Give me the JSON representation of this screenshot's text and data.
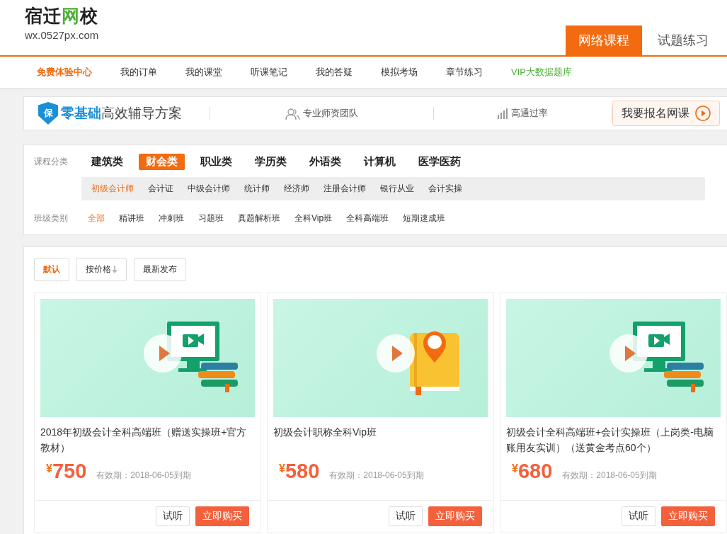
{
  "logo": {
    "title_parts": [
      {
        "text": "宿迁",
        "accent": false
      },
      {
        "text": "网",
        "accent": true
      },
      {
        "text": "校",
        "accent": false
      }
    ],
    "url": "wx.0527px.com"
  },
  "top_tabs": [
    {
      "label": "网络课程",
      "selected": true
    },
    {
      "label": "试题练习",
      "selected": false
    }
  ],
  "nav": [
    {
      "label": "免费体验中心",
      "selected": true,
      "kind": "normal"
    },
    {
      "label": "我的订单",
      "selected": false,
      "kind": "normal"
    },
    {
      "label": "我的课堂",
      "selected": false,
      "kind": "normal"
    },
    {
      "label": "听课笔记",
      "selected": false,
      "kind": "normal"
    },
    {
      "label": "我的答疑",
      "selected": false,
      "kind": "normal"
    },
    {
      "label": "模拟考场",
      "selected": false,
      "kind": "normal"
    },
    {
      "label": "章节练习",
      "selected": false,
      "kind": "normal"
    },
    {
      "label": "VIP大数据题库",
      "selected": false,
      "kind": "vip"
    }
  ],
  "promo": {
    "badge": "保",
    "title_accent": "零基础",
    "title": "高效辅导方案",
    "features": [
      {
        "kind": "team",
        "label": "专业师资团队"
      },
      {
        "kind": "rate",
        "label": "高通过率"
      }
    ],
    "cta": "我要报名网课"
  },
  "filters": {
    "category_label": "课程分类",
    "categories": [
      {
        "label": "建筑类",
        "selected": false
      },
      {
        "label": "财会类",
        "selected": true
      },
      {
        "label": "职业类",
        "selected": false
      },
      {
        "label": "学历类",
        "selected": false
      },
      {
        "label": "外语类",
        "selected": false
      },
      {
        "label": "计算机",
        "selected": false
      },
      {
        "label": "医学医药",
        "selected": false
      }
    ],
    "subcategories": [
      {
        "label": "初级会计师",
        "selected": true
      },
      {
        "label": "会计证",
        "selected": false
      },
      {
        "label": "中级会计师",
        "selected": false
      },
      {
        "label": "统计师",
        "selected": false
      },
      {
        "label": "经济师",
        "selected": false
      },
      {
        "label": "注册会计师",
        "selected": false
      },
      {
        "label": "银行从业",
        "selected": false
      },
      {
        "label": "会计实操",
        "selected": false
      }
    ],
    "class_label": "班级类别",
    "classes": [
      {
        "label": "全部",
        "selected": true
      },
      {
        "label": "精讲班",
        "selected": false
      },
      {
        "label": "冲刺班",
        "selected": false
      },
      {
        "label": "习题班",
        "selected": false
      },
      {
        "label": "真题解析班",
        "selected": false
      },
      {
        "label": "全科Vip班",
        "selected": false
      },
      {
        "label": "全科高端班",
        "selected": false
      },
      {
        "label": "短期速成班",
        "selected": false
      }
    ]
  },
  "sort_buttons": [
    {
      "label": "默认",
      "selected": true,
      "sort_arrow": false
    },
    {
      "label": "按价格",
      "selected": false,
      "sort_arrow": true
    },
    {
      "label": "最新发布",
      "selected": false,
      "sort_arrow": false
    }
  ],
  "courses": [
    {
      "kind": "monitor",
      "title": "2018年初级会计全科高端班（赠送实操班+官方教材）",
      "currency": "¥",
      "price": "750",
      "validity": "有效期：2018-06-05到期",
      "trial": "试听",
      "buy": "立即购买"
    },
    {
      "kind": "book",
      "title": "初级会计职称全科Vip班",
      "currency": "¥",
      "price": "580",
      "validity": "有效期：2018-06-05到期",
      "trial": "试听",
      "buy": "立即购买"
    },
    {
      "kind": "monitor",
      "title": "初级会计全科高端班+会计实操班（上岗类-电脑账用友实训）（送黄金考点60个）",
      "currency": "¥",
      "price": "680",
      "validity": "有效期：2018-06-05到期",
      "trial": "试听",
      "buy": "立即购买"
    }
  ]
}
